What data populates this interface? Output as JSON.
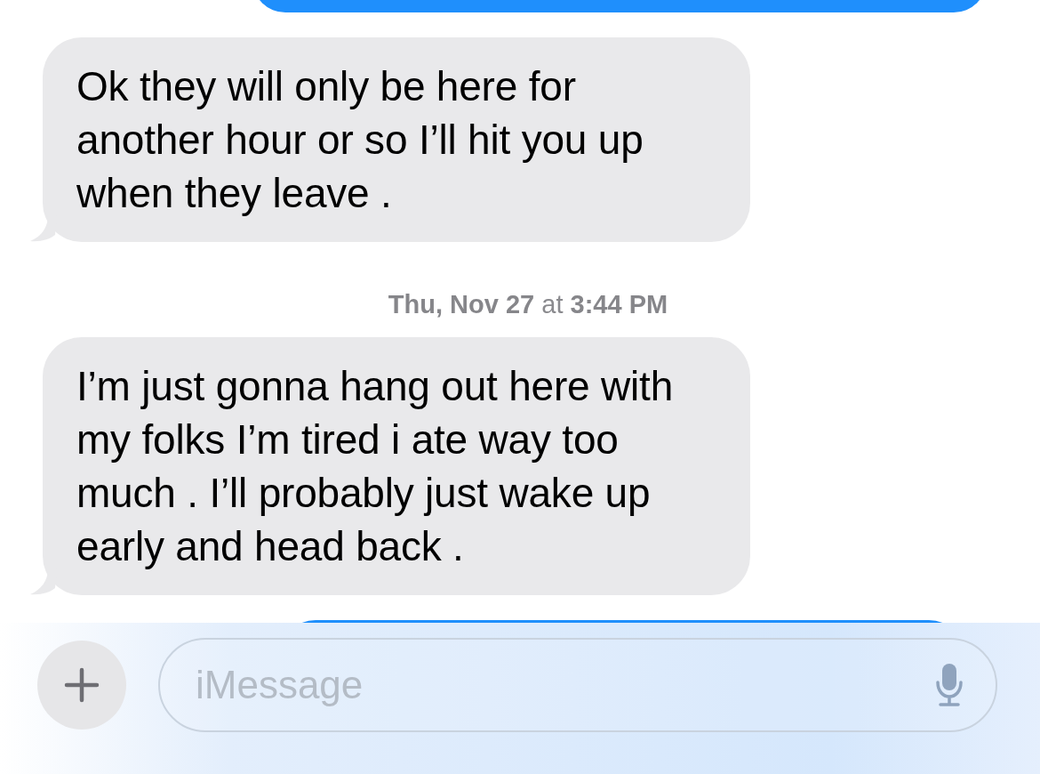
{
  "messages": [
    {
      "kind": "sent"
    },
    {
      "kind": "received",
      "text": "Ok they will only be here for another hour or so I’ll hit you up when they leave ."
    },
    {
      "kind": "time",
      "text": "**Thu, Nov 27** at **3:44 PM**"
    },
    {
      "kind": "received",
      "text": "I’m just gonna hang out here with my folks I’m tired i ate way too much . I’ll probably just wake up early and head back ."
    },
    {
      "kind": "sent"
    }
  ],
  "composer": {
    "placeholder": "iMessage"
  }
}
